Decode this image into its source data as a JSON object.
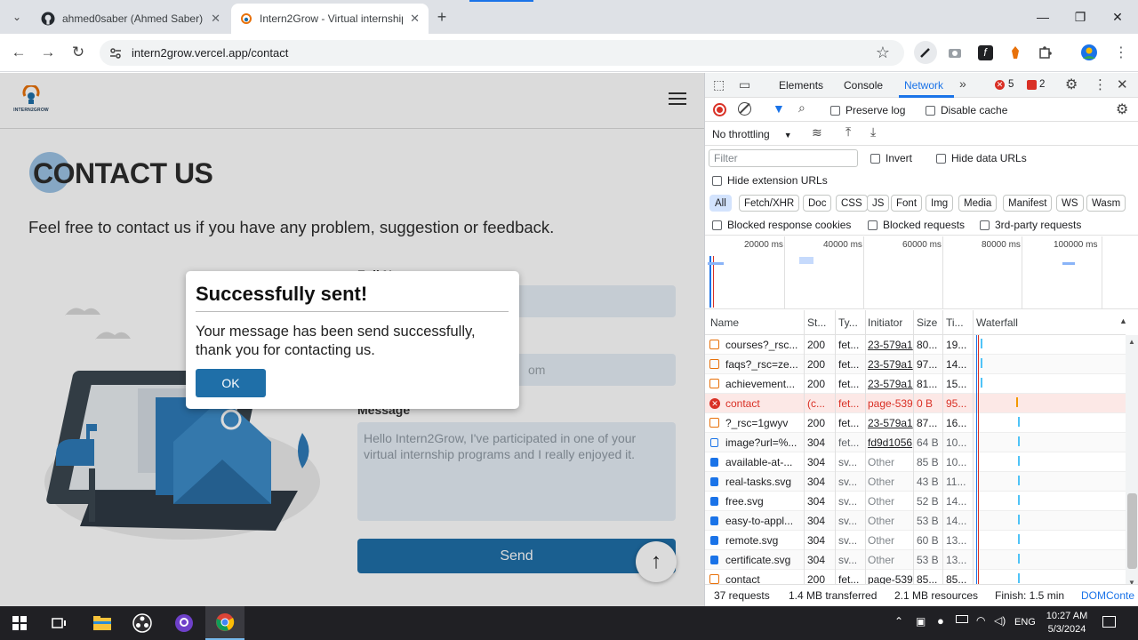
{
  "browser": {
    "tabs": [
      {
        "title": "ahmed0saber (Ahmed Saber)",
        "close": "✕"
      },
      {
        "title": "Intern2Grow - Virtual internship",
        "close": "✕"
      }
    ],
    "new_tab": "+",
    "url": "intern2grow.vercel.app/contact",
    "window_controls": [
      "—",
      "❐",
      "✕"
    ]
  },
  "site": {
    "logo_text": "INTERN2GROW",
    "title": "CONTACT US",
    "subtitle": "Feel free to contact us if you have any problem, suggestion or feedback.",
    "form": {
      "full_name_label": "Full Name",
      "email_placeholder_tail": "om",
      "message_label": "Message",
      "message_value": "Hello Intern2Grow, I've participated in one of your virtual internship programs and I really enjoyed it.",
      "send_label": "Send"
    }
  },
  "dialog": {
    "title": "Successfully sent!",
    "body": "Your message has been send successfully, thank you for contacting us.",
    "ok_label": "OK"
  },
  "devtools": {
    "tabs": [
      "Elements",
      "Console",
      "Network"
    ],
    "active_tab": "Network",
    "error_count": "5",
    "issue_count": "2",
    "preserve_log": "Preserve log",
    "disable_cache": "Disable cache",
    "throttling": "No throttling",
    "filter_placeholder": "Filter",
    "invert": "Invert",
    "hide_data_urls": "Hide data URLs",
    "hide_extension_urls": "Hide extension URLs",
    "type_filters": [
      "All",
      "Fetch/XHR",
      "Doc",
      "CSS",
      "JS",
      "Font",
      "Img",
      "Media",
      "Manifest",
      "WS",
      "Wasm"
    ],
    "blocked_response_cookies": "Blocked response cookies",
    "blocked_requests": "Blocked requests",
    "third_party": "3rd-party requests",
    "timeline_ticks": [
      "20000 ms",
      "40000 ms",
      "60000 ms",
      "80000 ms",
      "100000 ms"
    ],
    "columns": [
      "Name",
      "St...",
      "Ty...",
      "Initiator",
      "Size",
      "Ti...",
      "Waterfall"
    ],
    "rows": [
      {
        "name": "courses?_rsc...",
        "status": "200",
        "type": "fet...",
        "initiator": "23-579a1",
        "size": "80...",
        "time": "19...",
        "icon": "fetch",
        "error": false,
        "other": false
      },
      {
        "name": "faqs?_rsc=ze...",
        "status": "200",
        "type": "fet...",
        "initiator": "23-579a1",
        "size": "97...",
        "time": "14...",
        "icon": "fetch",
        "error": false,
        "other": false
      },
      {
        "name": "achievement...",
        "status": "200",
        "type": "fet...",
        "initiator": "23-579a1",
        "size": "81...",
        "time": "15...",
        "icon": "fetch",
        "error": false,
        "other": false
      },
      {
        "name": "contact",
        "status": "(c...",
        "type": "fet...",
        "initiator": "page-539",
        "size": "0 B",
        "time": "95...",
        "icon": "error",
        "error": true,
        "other": false
      },
      {
        "name": "?_rsc=1gwyv",
        "status": "200",
        "type": "fet...",
        "initiator": "23-579a1",
        "size": "87...",
        "time": "16...",
        "icon": "fetch",
        "error": false,
        "other": false
      },
      {
        "name": "image?url=%...",
        "status": "304",
        "type": "fet...",
        "initiator": "fd9d1056",
        "size": "64 B",
        "time": "10...",
        "icon": "image",
        "error": false,
        "other": false
      },
      {
        "name": "available-at-...",
        "status": "304",
        "type": "sv...",
        "initiator": "Other",
        "size": "85 B",
        "time": "10...",
        "icon": "svg",
        "error": false,
        "other": true
      },
      {
        "name": "real-tasks.svg",
        "status": "304",
        "type": "sv...",
        "initiator": "Other",
        "size": "43 B",
        "time": "11...",
        "icon": "svg",
        "error": false,
        "other": true
      },
      {
        "name": "free.svg",
        "status": "304",
        "type": "sv...",
        "initiator": "Other",
        "size": "52 B",
        "time": "14...",
        "icon": "svg",
        "error": false,
        "other": true
      },
      {
        "name": "easy-to-appl...",
        "status": "304",
        "type": "sv...",
        "initiator": "Other",
        "size": "53 B",
        "time": "14...",
        "icon": "svg",
        "error": false,
        "other": true
      },
      {
        "name": "remote.svg",
        "status": "304",
        "type": "sv...",
        "initiator": "Other",
        "size": "60 B",
        "time": "13...",
        "icon": "svg",
        "error": false,
        "other": true
      },
      {
        "name": "certificate.svg",
        "status": "304",
        "type": "sv...",
        "initiator": "Other",
        "size": "53 B",
        "time": "13...",
        "icon": "svg",
        "error": false,
        "other": true
      },
      {
        "name": "contact",
        "status": "200",
        "type": "fet...",
        "initiator": "page-539",
        "size": "85...",
        "time": "85...",
        "icon": "fetch",
        "error": false,
        "other": false
      }
    ],
    "status_bar": {
      "requests": "37 requests",
      "transferred": "1.4 MB transferred",
      "resources": "2.1 MB resources",
      "finish": "Finish: 1.5 min",
      "domcontent": "DOMConte"
    }
  },
  "taskbar": {
    "time": "10:27 AM",
    "date": "5/3/2024",
    "lang": "ENG"
  },
  "colors": {
    "accent": "#1a73e8",
    "site_blue": "#1f6fa8",
    "error_row": "#fce8e6",
    "error_red": "#d93025"
  }
}
